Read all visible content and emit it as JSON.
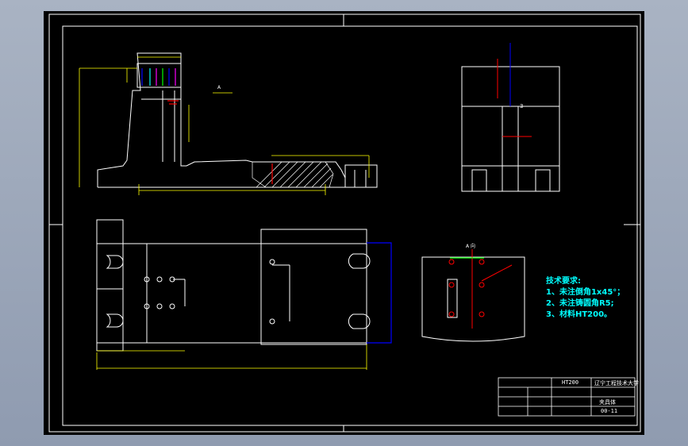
{
  "tech_requirements": {
    "title": "技术要求:",
    "items": [
      "1、未注倒角1x45°；",
      "2、未注铸圆角R5;",
      "3、材料HT200。"
    ]
  },
  "title_block": {
    "material": "HT200",
    "school": "辽宁工程技术大学",
    "drawing_name": "夹具体",
    "drawing_no": "00-11"
  },
  "labels": {
    "section_a": "A",
    "view_label": "A 向",
    "leader_3": "3"
  },
  "colors": {
    "background": "#000000",
    "outline": "#ffffff",
    "dimension": "#ffff00",
    "centerline": "#ff0000",
    "hatch": "#ffffff",
    "text": "#00ffff"
  }
}
